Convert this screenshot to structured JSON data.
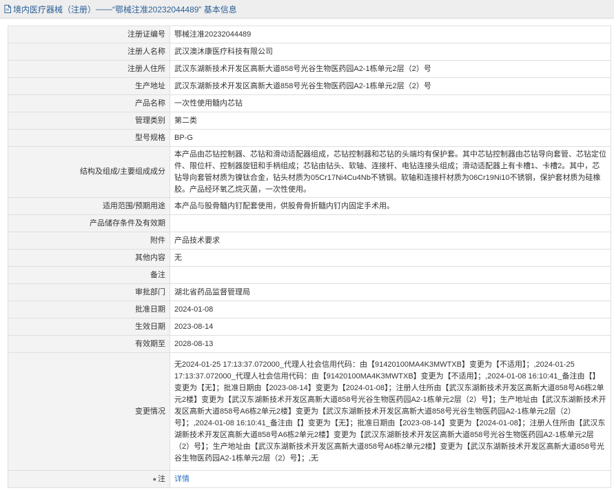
{
  "header": {
    "breadcrumb": "境内医疗器械（注册）",
    "separator": " —— ",
    "title": "“鄂械注准20232044489” 基本信息"
  },
  "rows": [
    {
      "label": "注册证编号",
      "value": "鄂械注准20232044489"
    },
    {
      "label": "注册人名称",
      "value": "武汉澳沐康医疗科技有限公司"
    },
    {
      "label": "注册人住所",
      "value": "武汉东湖新技术开发区高新大道858号光谷生物医药园A2-1栋单元2层（2）号"
    },
    {
      "label": "生产地址",
      "value": "武汉东湖新技术开发区高新大道858号光谷生物医药园A2-1栋单元2层（2）号"
    },
    {
      "label": "产品名称",
      "value": "一次性使用髓内芯钻"
    },
    {
      "label": "管理类别",
      "value": "第二类"
    },
    {
      "label": "型号规格",
      "value": "BP-G"
    },
    {
      "label": "结构及组成/主要组成成分",
      "value": "本产品由芯钻控制器、芯钻和滑动适配器组成，芯钻控制器和芯钻的头端均有保护套。其中芯钻控制器由芯钻导向套管、芯钻定位件、限位杆、控制器旋钮和手柄组成；芯钻由钻头、软轴、连接杆、电钻连接头组成；滑动适配器上有卡槽1、卡槽2。其中，芯钻导向套管材质为镍钛合金，钻头材质为05Cr17Ni4Cu4Nb不锈钢。软轴和连接杆材质为06Cr19Ni10不锈钢，保护套材质为硅橡胶。产品经环氧乙烷灭菌，一次性使用。"
    },
    {
      "label": "适用范围/预期用途",
      "value": "本产品与股骨髓内钉配套使用，供股骨骨折髓内钉内固定手术用。"
    },
    {
      "label": "产品储存条件及有效期",
      "value": ""
    },
    {
      "label": "附件",
      "value": "产品技术要求"
    },
    {
      "label": "其他内容",
      "value": "无"
    },
    {
      "label": "备注",
      "value": ""
    },
    {
      "label": "审批部门",
      "value": "湖北省药品监督管理局"
    },
    {
      "label": "批准日期",
      "value": "2024-01-08"
    },
    {
      "label": "生效日期",
      "value": "2023-08-14"
    },
    {
      "label": "有效期至",
      "value": "2028-08-13"
    },
    {
      "label": "变更情况",
      "value": "无2024-01-25 17:13:37.072000_代理人社会信用代码：由【91420100MA4K3MWTXB】变更为【不适用】；,2024-01-25 17:13:37.072000_代理人社会信用代码：由【91420100MA4K3MWTXB】变更为【不适用】；,2024-01-08 16:10:41_备注由【】变更为【无】；批准日期由【2023-08-14】变更为【2024-01-08】；注册人住所由【武汉东湖新技术开发区高新大道858号A6栋2单元2楼】变更为【武汉东湖新技术开发区高新大道858号光谷生物医药园A2-1栋单元2层（2）号】；生产地址由【武汉东湖新技术开发区高新大道858号A6栋2单元2楼】变更为【武汉东湖新技术开发区高新大道858号光谷生物医药园A2-1栋单元2层（2）号】；,2024-01-08 16:10:41_备注由【】变更为【无】；批准日期由【2023-08-14】变更为【2024-01-08】；注册人住所由【武汉东湖新技术开发区高新大道858号A6栋2单元2楼】变更为【武汉东湖新技术开发区高新大道858号光谷生物医药园A2-1栋单元2层（2）号】；生产地址由【武汉东湖新技术开发区高新大道858号A6栋2单元2楼】变更为【武汉东湖新技术开发区高新大道858号光谷生物医药园A2-1栋单元2层（2）号】；,无"
    }
  ],
  "footer_row": {
    "label": "注",
    "value": "详情"
  },
  "icons": {
    "title_icon": "document-icon",
    "note_icon": "pin-icon"
  },
  "colors": {
    "title_text": "#2c5f96",
    "link": "#2c6fbf",
    "label_bg": "#f3f3f3"
  }
}
